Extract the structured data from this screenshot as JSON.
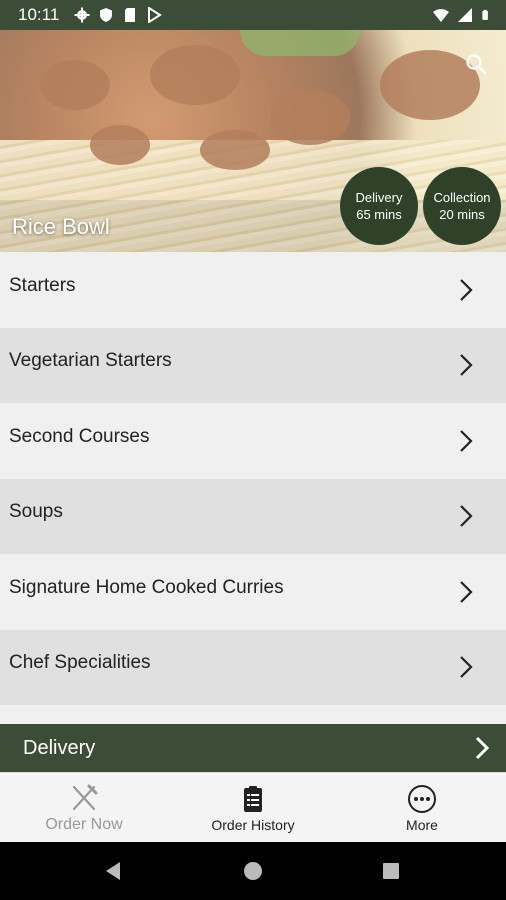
{
  "status": {
    "time": "10:11"
  },
  "hero": {
    "restaurant_name": "Rice Bowl",
    "delivery": {
      "label": "Delivery",
      "time": "65 mins"
    },
    "collection": {
      "label": "Collection",
      "time": "20 mins"
    }
  },
  "menu": {
    "items": [
      {
        "label": "Starters"
      },
      {
        "label": "Vegetarian Starters"
      },
      {
        "label": "Second Courses"
      },
      {
        "label": "Soups"
      },
      {
        "label": "Signature Home Cooked Curries"
      },
      {
        "label": "Chef Specialities"
      }
    ]
  },
  "order_mode": {
    "label": "Delivery"
  },
  "tabs": {
    "order_now": "Order Now",
    "order_history": "Order History",
    "more": "More"
  },
  "colors": {
    "brand": "#3b4d36",
    "pill": "#2f4229",
    "row_light": "#f0f0f0",
    "row_dark": "#e0e0e0"
  }
}
